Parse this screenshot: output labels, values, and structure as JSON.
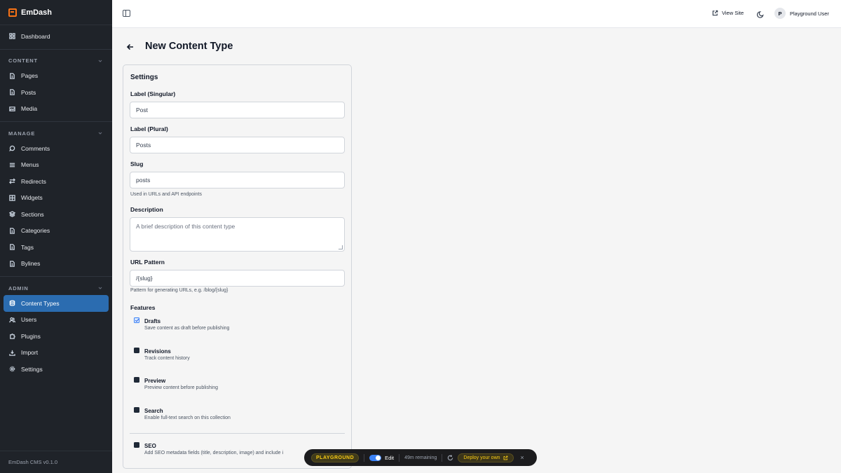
{
  "app": {
    "name": "EmDash",
    "version": "EmDash CMS v0.1.0"
  },
  "sidebar": {
    "dashboard": "Dashboard",
    "content": {
      "heading": "CONTENT",
      "items": [
        "Pages",
        "Posts",
        "Media"
      ]
    },
    "manage": {
      "heading": "MANAGE",
      "items": [
        "Comments",
        "Menus",
        "Redirects",
        "Widgets",
        "Sections",
        "Categories",
        "Tags",
        "Bylines"
      ]
    },
    "admin": {
      "heading": "ADMIN",
      "items": [
        "Content Types",
        "Users",
        "Plugins",
        "Import",
        "Settings"
      ]
    },
    "active": "Content Types"
  },
  "topbar": {
    "view_site": "View Site",
    "user_initial": "P",
    "user_name": "Playground User"
  },
  "page": {
    "title": "New Content Type"
  },
  "settings": {
    "title": "Settings",
    "label_singular": {
      "label": "Label (Singular)",
      "value": "Post"
    },
    "label_plural": {
      "label": "Label (Plural)",
      "value": "Posts"
    },
    "slug": {
      "label": "Slug",
      "value": "posts",
      "help": "Used in URLs and API endpoints"
    },
    "description": {
      "label": "Description",
      "placeholder": "A brief description of this content type"
    },
    "url_pattern": {
      "label": "URL Pattern",
      "value": "/{slug}",
      "help": "Pattern for generating URLs, e.g. /blog/{slug}"
    },
    "features": {
      "label": "Features",
      "items": [
        {
          "name": "Drafts",
          "desc": "Save content as draft before publishing",
          "checked": true
        },
        {
          "name": "Revisions",
          "desc": "Track content history",
          "checked": false
        },
        {
          "name": "Preview",
          "desc": "Preview content before publishing",
          "checked": false
        },
        {
          "name": "Search",
          "desc": "Enable full-text search on this collection",
          "checked": false
        },
        {
          "name": "SEO",
          "desc": "Add SEO metadata fields (title, description, image) and include i",
          "checked": false
        }
      ]
    }
  },
  "playground": {
    "badge": "PLAYGROUND",
    "edit": "Edit",
    "remaining": "49m remaining",
    "deploy": "Deploy your own",
    "close": "×"
  }
}
